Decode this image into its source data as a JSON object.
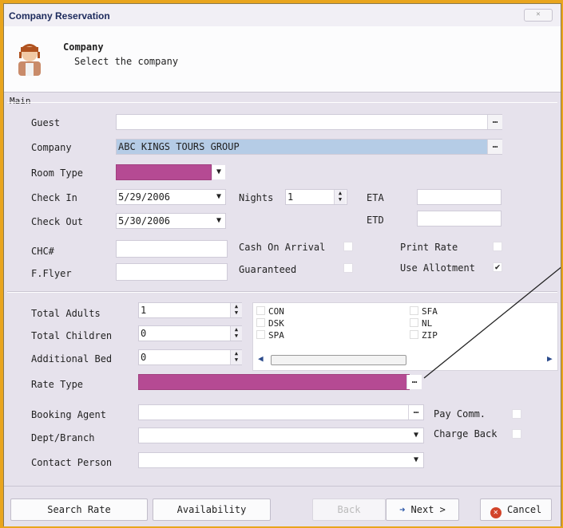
{
  "window": {
    "title": "Company Reservation",
    "close_label": "✕"
  },
  "header": {
    "title": "Company",
    "subtitle": "Select the company"
  },
  "section": {
    "main_label": "Main"
  },
  "form": {
    "guest_label": "Guest",
    "guest_value": "",
    "company_label": "Company",
    "company_value": "ABC KINGS TOURS GROUP",
    "room_type_label": "Room Type",
    "room_type_value": "",
    "check_in_label": "Check In",
    "check_in_value": "5/29/2006",
    "check_out_label": "Check Out",
    "check_out_value": "5/30/2006",
    "nights_label": "Nights",
    "nights_value": "1",
    "eta_label": "ETA",
    "eta_value": "",
    "etd_label": "ETD",
    "etd_value": "",
    "chc_label": "CHC#",
    "chc_value": "",
    "fflyer_label": "F.Flyer",
    "fflyer_value": "",
    "cash_on_arrival_label": "Cash On Arrival",
    "cash_on_arrival_checked": false,
    "guaranteed_label": "Guaranteed",
    "guaranteed_checked": false,
    "print_rate_label": "Print Rate",
    "print_rate_checked": false,
    "use_allotment_label": "Use Allotment",
    "use_allotment_checked": true,
    "total_adults_label": "Total Adults",
    "total_adults_value": "1",
    "total_children_label": "Total Children",
    "total_children_value": "0",
    "additional_bed_label": "Additional Bed",
    "additional_bed_value": "0",
    "rate_type_label": "Rate Type",
    "rate_type_value": "",
    "booking_agent_label": "Booking Agent",
    "booking_agent_value": "",
    "dept_branch_label": "Dept/Branch",
    "dept_branch_value": "",
    "contact_person_label": "Contact Person",
    "contact_person_value": "",
    "pay_comm_label": "Pay Comm.",
    "pay_comm_checked": false,
    "charge_back_label": "Charge Back",
    "charge_back_checked": false
  },
  "codes": {
    "col1": [
      "CON",
      "DSK",
      "SPA"
    ],
    "col2": [
      "SFA",
      "NL",
      "ZIP"
    ]
  },
  "buttons": {
    "search_rate": "Search Rate",
    "availability": "Availability",
    "back": "Back",
    "next": "Next >",
    "cancel": "Cancel"
  },
  "symbols": {
    "ellipsis": "…",
    "dropdown": "▼",
    "check": "✔"
  },
  "colors": {
    "highlight_magenta": "#b54a93",
    "selection_blue": "#b5cce6",
    "frame_orange": "#e9a51d"
  }
}
